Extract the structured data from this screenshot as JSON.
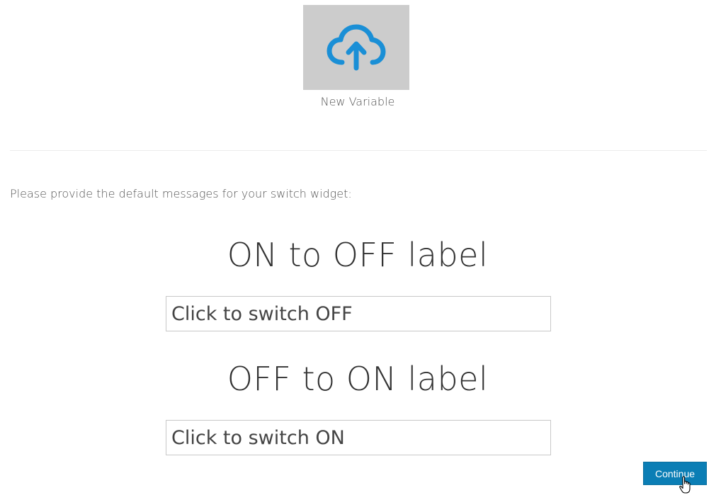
{
  "tile": {
    "label": "New Variable",
    "icon": "cloud-upload-icon",
    "icon_color": "#1a8fd6",
    "background": "#cccccc"
  },
  "instructions": "Please provide the default messages for your switch widget:",
  "on_to_off": {
    "heading": "ON to OFF label",
    "value": "Click to switch OFF"
  },
  "off_to_on": {
    "heading": "OFF to ON label",
    "value": "Click to switch ON"
  },
  "continue_button": {
    "label": "Continue",
    "color": "#0b7eb5"
  }
}
